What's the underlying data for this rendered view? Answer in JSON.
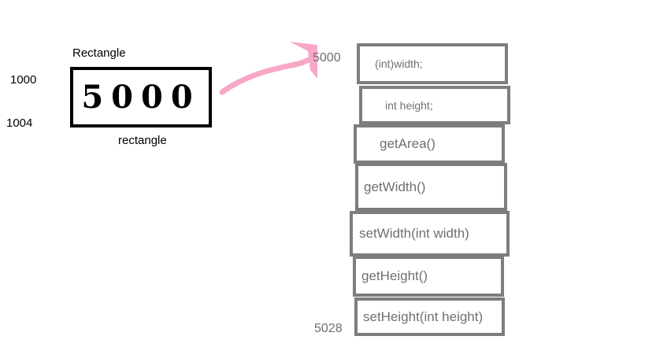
{
  "reference": {
    "class_label": "Rectangle",
    "variable_label": "rectangle",
    "value": "5000",
    "address_top": "1000",
    "address_bottom": "1004"
  },
  "object": {
    "start_address": "5000",
    "end_address": "5028",
    "members": [
      "(int)width;",
      "int height;",
      "getArea()",
      "getWidth()",
      "setWidth(int width)",
      "getHeight()",
      "setHeight(int height)"
    ]
  },
  "colors": {
    "arrow": "#f7a8c8",
    "slot_border": "#7d7d7d",
    "slot_text": "#707070",
    "reference_border": "#000000"
  }
}
